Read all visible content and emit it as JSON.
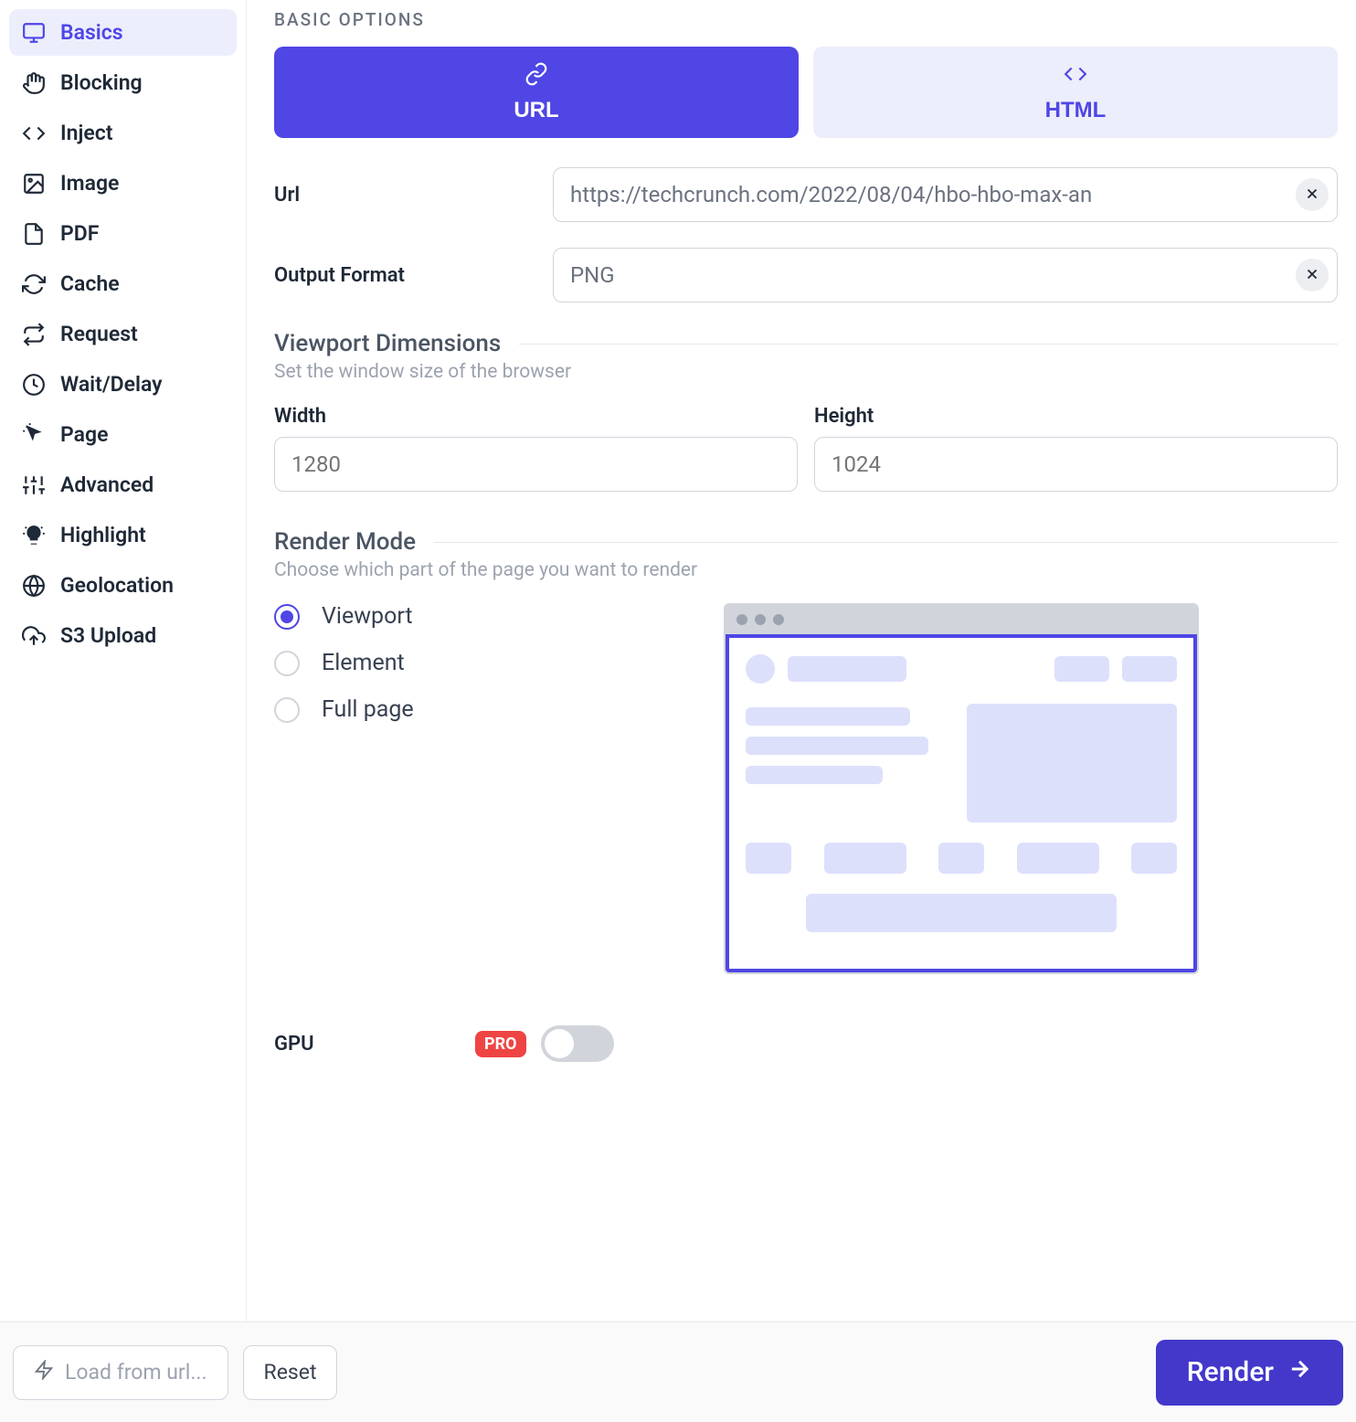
{
  "sidebar": {
    "items": [
      {
        "label": "Basics",
        "icon": "monitor",
        "active": true
      },
      {
        "label": "Blocking",
        "icon": "hand",
        "active": false
      },
      {
        "label": "Inject",
        "icon": "code",
        "active": false
      },
      {
        "label": "Image",
        "icon": "image",
        "active": false
      },
      {
        "label": "PDF",
        "icon": "file",
        "active": false
      },
      {
        "label": "Cache",
        "icon": "refresh",
        "active": false
      },
      {
        "label": "Request",
        "icon": "swap",
        "active": false
      },
      {
        "label": "Wait/Delay",
        "icon": "clock",
        "active": false
      },
      {
        "label": "Page",
        "icon": "cursor",
        "active": false
      },
      {
        "label": "Advanced",
        "icon": "sliders",
        "active": false
      },
      {
        "label": "Highlight",
        "icon": "bulb",
        "active": false
      },
      {
        "label": "Geolocation",
        "icon": "globe",
        "active": false
      },
      {
        "label": "S3 Upload",
        "icon": "upload",
        "active": false
      }
    ]
  },
  "header": {
    "section_label": "BASIC OPTIONS"
  },
  "tabs": {
    "url_label": "URL",
    "html_label": "HTML",
    "active": "url"
  },
  "fields": {
    "url": {
      "label": "Url",
      "value": "https://techcrunch.com/2022/08/04/hbo-hbo-max-an"
    },
    "output_format": {
      "label": "Output Format",
      "value": "PNG"
    }
  },
  "viewport": {
    "title": "Viewport Dimensions",
    "desc": "Set the window size of the browser",
    "width_label": "Width",
    "height_label": "Height",
    "width_placeholder": "1280",
    "height_placeholder": "1024"
  },
  "render_mode": {
    "title": "Render Mode",
    "desc": "Choose which part of the page you want to render",
    "options": [
      "Viewport",
      "Element",
      "Full page"
    ],
    "selected": "Viewport"
  },
  "gpu": {
    "label": "GPU",
    "badge": "PRO",
    "enabled": false
  },
  "footer": {
    "load_label": "Load from url...",
    "reset_label": "Reset",
    "render_label": "Render"
  }
}
